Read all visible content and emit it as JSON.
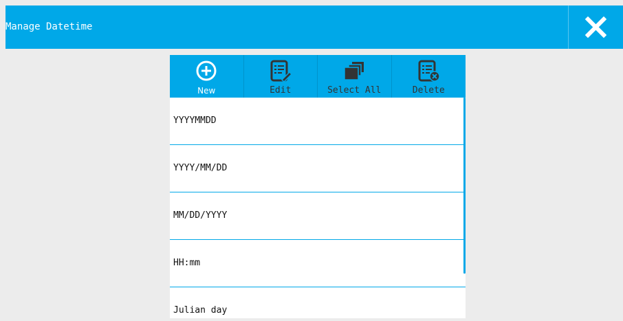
{
  "header": {
    "title": "Manage Datetime",
    "close_icon": "close-x-icon"
  },
  "toolbar": {
    "items": [
      {
        "label": "New",
        "icon": "plus-circle-icon"
      },
      {
        "label": "Edit",
        "icon": "edit-document-icon"
      },
      {
        "label": "Select All",
        "icon": "stacked-pages-icon"
      },
      {
        "label": "Delete",
        "icon": "delete-document-icon"
      }
    ]
  },
  "list": {
    "items": [
      {
        "label": "YYYYMMDD"
      },
      {
        "label": "YYYY/MM/DD"
      },
      {
        "label": "MM/DD/YYYY"
      },
      {
        "label": "HH:mm"
      },
      {
        "label": "Julian day"
      }
    ]
  },
  "colors": {
    "accent": "#00a8e8",
    "background": "#ececec",
    "icon": "#333333"
  }
}
